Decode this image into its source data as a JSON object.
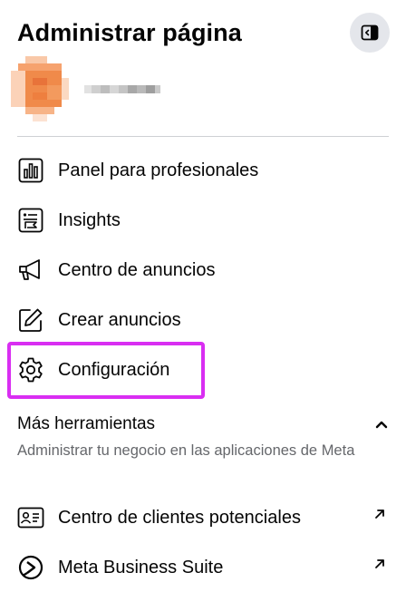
{
  "header": {
    "title": "Administrar página"
  },
  "nav": {
    "items": [
      {
        "label": "Panel para profesionales",
        "icon": "bar-chart-icon"
      },
      {
        "label": "Insights",
        "icon": "insights-icon"
      },
      {
        "label": "Centro de anuncios",
        "icon": "megaphone-icon"
      },
      {
        "label": "Crear anuncios",
        "icon": "pencil-icon"
      },
      {
        "label": "Configuración",
        "icon": "gear-icon"
      }
    ]
  },
  "tools": {
    "title": "Más herramientas",
    "subtitle": "Administrar tu negocio en las aplicaciones de Meta",
    "items": [
      {
        "label": "Centro de clientes potenciales",
        "icon": "contact-card-icon"
      },
      {
        "label": "Meta Business Suite",
        "icon": "meta-business-suite-icon"
      }
    ]
  },
  "colors": {
    "highlight": "#d92ef2",
    "button_bg": "#e4e6eb",
    "secondary_text": "#65676b",
    "divider": "#ced0d4"
  }
}
